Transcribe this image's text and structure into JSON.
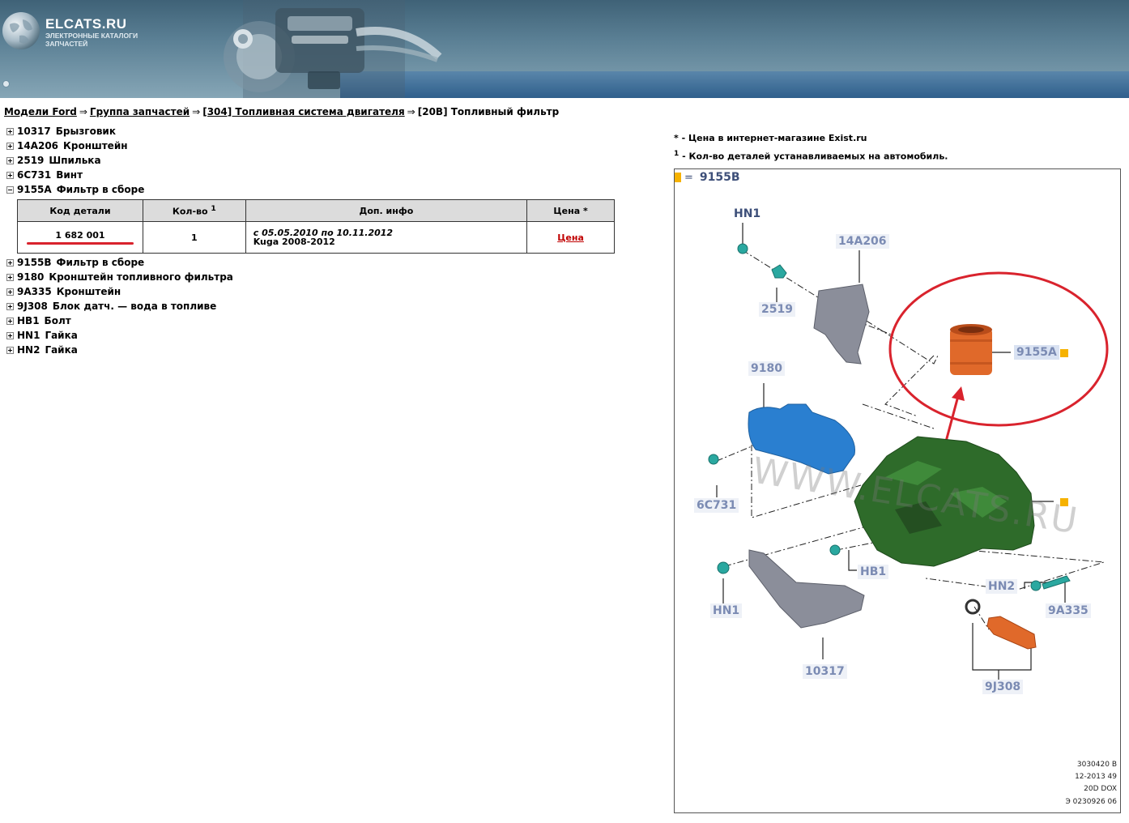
{
  "header": {
    "brand": "ELCATS.RU",
    "tagline_1": "ЭЛЕКТРОННЫЕ КАТАЛОГИ",
    "tagline_2": "ЗАПЧАСТЕЙ"
  },
  "breadcrumb": {
    "models": "Модели Ford",
    "group": "Группа запчастей",
    "system": "[304] Топливная система двигателя",
    "current": "[20B] Топливный фильтр",
    "separator": "⇒"
  },
  "tree": [
    {
      "code": "10317",
      "name": "Брызговик",
      "expanded": false
    },
    {
      "code": "14A206",
      "name": "Кронштейн",
      "expanded": false
    },
    {
      "code": "2519",
      "name": "Шпилька",
      "expanded": false
    },
    {
      "code": "6C731",
      "name": "Винт",
      "expanded": false
    },
    {
      "code": "9155A",
      "name": "Фильтр в сборе",
      "expanded": true
    },
    {
      "code": "9155B",
      "name": "Фильтр в сборе",
      "expanded": false
    },
    {
      "code": "9180",
      "name": "Кронштейн топливного фильтра",
      "expanded": false
    },
    {
      "code": "9A335",
      "name": "Кронштейн",
      "expanded": false
    },
    {
      "code": "9J308",
      "name": "Блок датч. — вода в топливе",
      "expanded": false
    },
    {
      "code": "HB1",
      "name": "Болт",
      "expanded": false
    },
    {
      "code": "HN1",
      "name": "Гайка",
      "expanded": false
    },
    {
      "code": "HN2",
      "name": "Гайка",
      "expanded": false
    }
  ],
  "table": {
    "headers": {
      "code": "Код детали",
      "qty": "Кол-во",
      "qty_sup": "1",
      "info": "Доп. инфо",
      "price": "Цена *"
    },
    "rows": [
      {
        "code": "1 682 001",
        "qty": "1",
        "dates": "с 05.05.2010 по 10.11.2012",
        "model": "Kuga 2008-2012",
        "price": "Цена"
      }
    ]
  },
  "notes": {
    "price_note": "* - Цена в интернет-магазине Exist.ru",
    "qty_sup": "1",
    "qty_note": "- Кол-во деталей устанавливаемых на автомобиль."
  },
  "diagram": {
    "legend_eq": "=",
    "legend_code": "9155B",
    "labels": {
      "hn1_top": "HN1",
      "a14206": "14A206",
      "s2519": "2519",
      "f9155a": "9155A",
      "b9180": "9180",
      "c6c731": "6C731",
      "hb1": "HB1",
      "hn1_bottom": "HN1",
      "hn2": "HN2",
      "a9a335": "9A335",
      "b10317": "10317",
      "j9j308": "9J308"
    },
    "watermark": "WWW.ELCATS.RU",
    "stamp": [
      "3030420 B",
      "12-2013 49",
      "20D DOX",
      "Э 0230926 06"
    ],
    "colors": {
      "marker": "#f6b200",
      "highlight_circle": "#d9232d",
      "filter": "#e0692a",
      "housing": "#2e6b2a",
      "bracket_blue": "#2a7fd0"
    }
  }
}
